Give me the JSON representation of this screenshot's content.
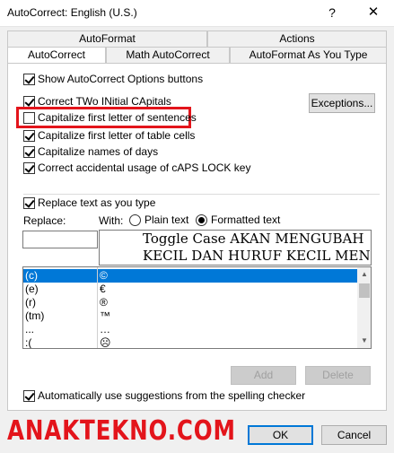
{
  "window": {
    "title": "AutoCorrect: English (U.S.)",
    "help_glyph": "?",
    "close_glyph": "✕"
  },
  "tabs": {
    "top": [
      "AutoFormat",
      "Actions"
    ],
    "bottom": [
      "AutoCorrect",
      "Math AutoCorrect",
      "AutoFormat As You Type"
    ],
    "active": "AutoCorrect"
  },
  "options": {
    "show_buttons": {
      "label": "Show AutoCorrect Options buttons",
      "checked": true
    },
    "correct_two_initials": {
      "label": "Correct TWo INitial CApitals",
      "checked": true
    },
    "capitalize_first_sentence": {
      "label": "Capitalize first letter of sentences",
      "checked": false
    },
    "capitalize_table_cells": {
      "label": "Capitalize first letter of table cells",
      "checked": true
    },
    "capitalize_days": {
      "label": "Capitalize names of days",
      "checked": true
    },
    "correct_caps_lock": {
      "label": "Correct accidental usage of cAPS LOCK key",
      "checked": true
    },
    "replace_as_you_type": {
      "label": "Replace text as you type",
      "checked": true
    },
    "use_suggestions": {
      "label": "Automatically use suggestions from the spelling checker",
      "checked": true
    }
  },
  "buttons": {
    "exceptions": "Exceptions...",
    "add": "Add",
    "delete": "Delete",
    "ok": "OK",
    "cancel": "Cancel"
  },
  "replace": {
    "replace_label": "Replace:",
    "with_label": "With:",
    "plain_text": "Plain text",
    "formatted_text": "Formatted text",
    "selected_mode": "Formatted text",
    "replace_value": "",
    "preview_lines": [
      "Toggle Case AKAN MENGUBAH",
      "KECIL DAN HURUF KECIL MEN"
    ]
  },
  "entries": [
    {
      "from": "(c)",
      "to": "©"
    },
    {
      "from": "(e)",
      "to": "€"
    },
    {
      "from": "(r)",
      "to": "®"
    },
    {
      "from": "(tm)",
      "to": "™"
    },
    {
      "from": "...",
      "to": "…"
    },
    {
      "from": ":(",
      "to": "☹"
    }
  ],
  "watermark": "ANAKTEKNO.COM",
  "colors": {
    "highlight": "#e3141b",
    "selection": "#0078d7"
  }
}
